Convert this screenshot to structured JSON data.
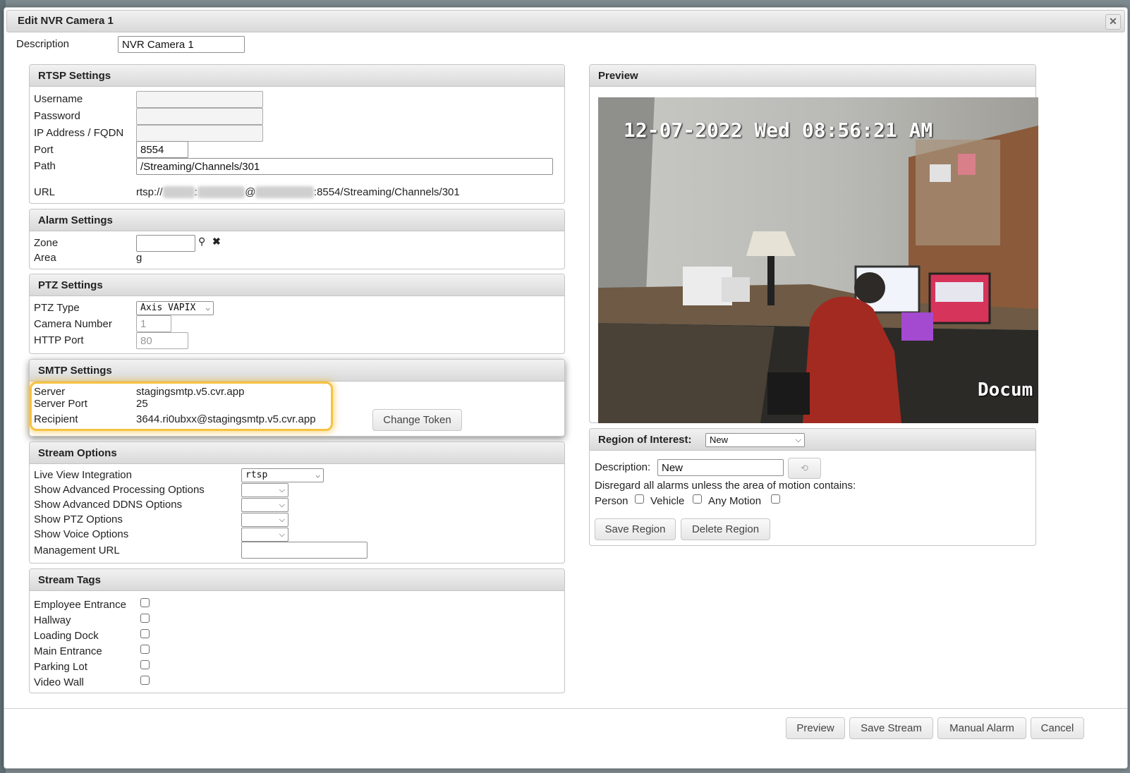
{
  "dialog": {
    "title": "Edit NVR Camera 1",
    "close_icon": "close-icon"
  },
  "description": {
    "label": "Description",
    "value": "NVR Camera 1"
  },
  "rtsp": {
    "title": "RTSP Settings",
    "username_label": "Username",
    "password_label": "Password",
    "ip_label": "IP Address / FQDN",
    "port_label": "Port",
    "port_value": "8554",
    "path_label": "Path",
    "path_value": "/Streaming/Channels/301",
    "url_label": "URL",
    "url_prefix": "rtsp://",
    "url_colon": ":",
    "url_at": "@",
    "url_suffix": ":8554/Streaming/Channels/301"
  },
  "alarm": {
    "title": "Alarm Settings",
    "zone_label": "Zone",
    "zone_value": "",
    "area_label": "Area",
    "area_value": "g",
    "search_icon": "search-icon",
    "clear_icon": "close-icon"
  },
  "ptz": {
    "title": "PTZ Settings",
    "type_label": "PTZ Type",
    "type_value": "Axis VAPIX",
    "camera_number_label": "Camera Number",
    "camera_number_value": "1",
    "http_port_label": "HTTP Port",
    "http_port_value": "80"
  },
  "smtp": {
    "title": "SMTP Settings",
    "server_label": "Server",
    "server_value": "stagingsmtp.v5.cvr.app",
    "server_port_label": "Server Port",
    "server_port_value": "25",
    "recipient_label": "Recipient",
    "recipient_value": "3644.ri0ubxx@stagingsmtp.v5.cvr.app",
    "change_token_label": "Change Token",
    "highlight_color": "#f5c242"
  },
  "stream_options": {
    "title": "Stream Options",
    "live_view_label": "Live View Integration",
    "live_view_value": "rtsp",
    "adv_processing_label": "Show Advanced Processing Options",
    "adv_ddns_label": "Show Advanced DDNS Options",
    "ptz_options_label": "Show PTZ Options",
    "voice_options_label": "Show Voice Options",
    "management_url_label": "Management URL",
    "management_url_value": ""
  },
  "stream_tags": {
    "title": "Stream Tags",
    "tags": [
      "Employee Entrance",
      "Hallway",
      "Loading Dock",
      "Main Entrance",
      "Parking Lot",
      "Video Wall"
    ]
  },
  "preview": {
    "title": "Preview",
    "overlay_timestamp": "12-07-2022 Wed 08:56:21 AM",
    "overlay_corner_text": "Docum"
  },
  "roi": {
    "title": "Region of Interest:",
    "select_value": "New",
    "description_label": "Description:",
    "description_value": "New",
    "refresh_icon": "refresh-icon",
    "disregard_text": "Disregard all alarms unless the area of motion contains:",
    "person_label": "Person",
    "vehicle_label": "Vehicle",
    "any_motion_label": "Any Motion",
    "save_region_label": "Save Region",
    "delete_region_label": "Delete Region"
  },
  "footer": {
    "preview_label": "Preview",
    "save_stream_label": "Save Stream",
    "manual_alarm_label": "Manual Alarm",
    "cancel_label": "Cancel"
  }
}
